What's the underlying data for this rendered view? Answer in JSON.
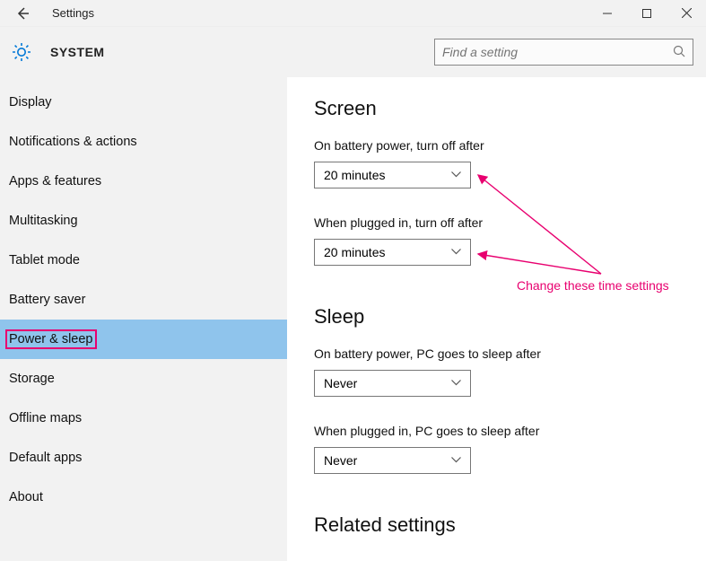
{
  "window": {
    "title": "Settings"
  },
  "header": {
    "system_label": "SYSTEM",
    "search_placeholder": "Find a setting"
  },
  "sidebar": {
    "items": [
      {
        "label": "Display"
      },
      {
        "label": "Notifications & actions"
      },
      {
        "label": "Apps & features"
      },
      {
        "label": "Multitasking"
      },
      {
        "label": "Tablet mode"
      },
      {
        "label": "Battery saver"
      },
      {
        "label": "Power & sleep"
      },
      {
        "label": "Storage"
      },
      {
        "label": "Offline maps"
      },
      {
        "label": "Default apps"
      },
      {
        "label": "About"
      }
    ],
    "selected_index": 6
  },
  "content": {
    "screen": {
      "heading": "Screen",
      "battery_label": "On battery power, turn off after",
      "battery_value": "20 minutes",
      "plugged_label": "When plugged in, turn off after",
      "plugged_value": "20 minutes"
    },
    "sleep": {
      "heading": "Sleep",
      "battery_label": "On battery power, PC goes to sleep after",
      "battery_value": "Never",
      "plugged_label": "When plugged in, PC goes to sleep after",
      "plugged_value": "Never"
    },
    "related_heading": "Related settings"
  },
  "annotation": {
    "text": "Change these time settings",
    "color": "#e8006f"
  }
}
